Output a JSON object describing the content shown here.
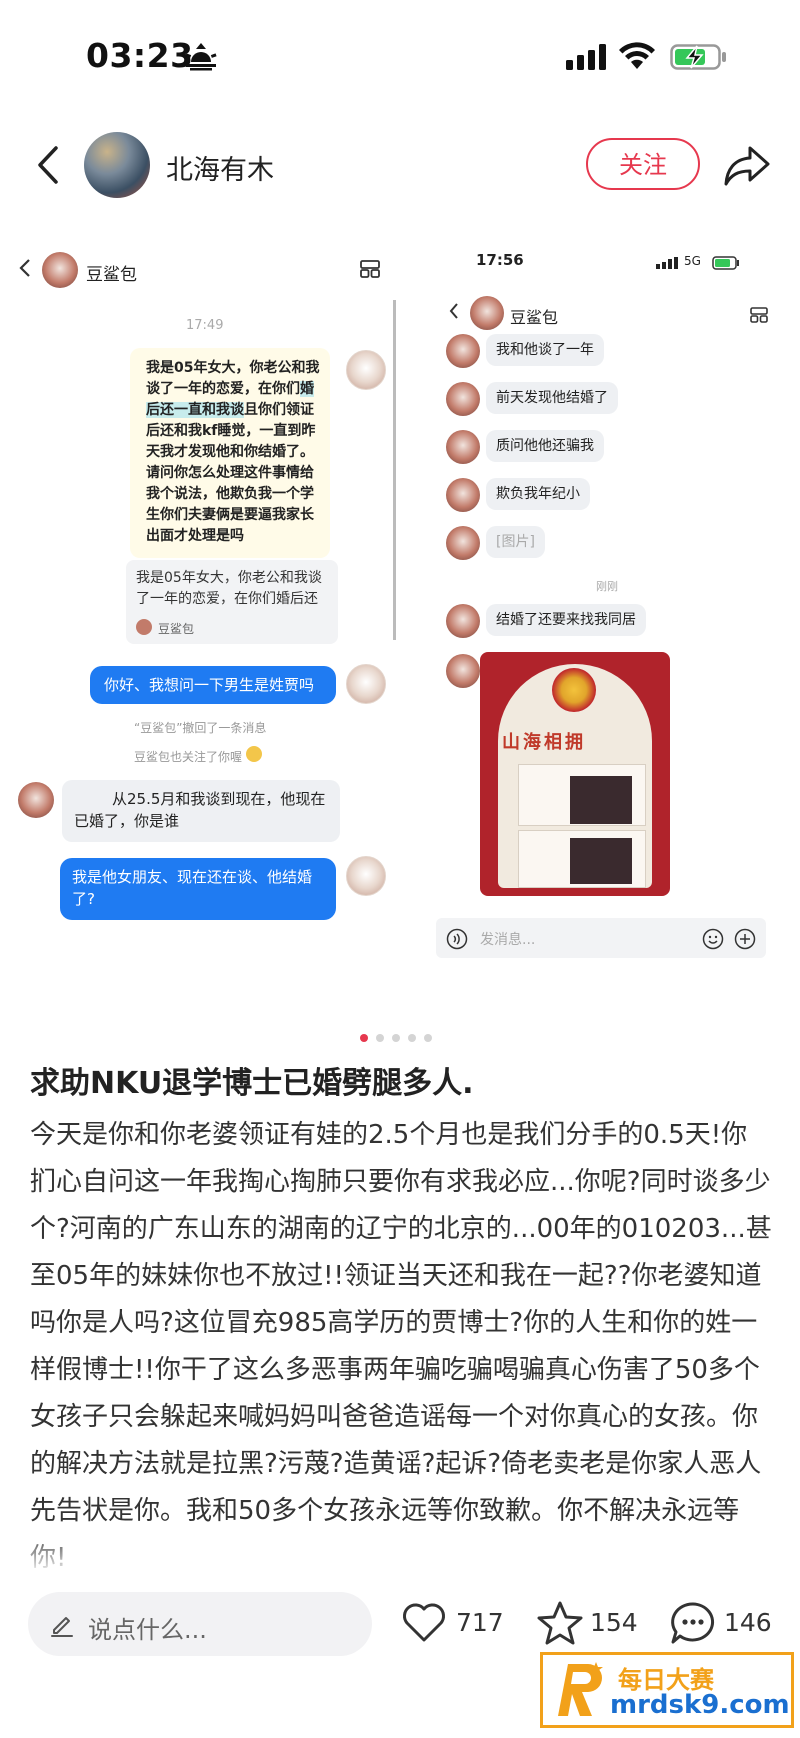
{
  "status_bar": {
    "time": "03:23"
  },
  "header": {
    "author": "北海有木",
    "follow_label": "关注"
  },
  "left_chat": {
    "contact_name": "豆鲨包",
    "time_label": "17:49",
    "image_message_pre": "我是05年女大，你老公和我谈了一年的恋爱，在你们",
    "image_message_highlight": "婚后还一直和我谈",
    "image_message_post": "且你们领证后还和我kf睡觉，一直到昨天我才发现他和你结婚了。请问你怎么处理这件事情给我个说法，他欺负我一个学生你们夫妻俩是要逼我家长出面才处理是吗",
    "quote_text": "我是05年女大，你老公和我谈了一年的恋爱，在你们婚后还",
    "quote_name": "豆鲨包",
    "msg_question": "你好、我想问一下男生是姓贾吗",
    "sys_recalled": "“豆鲨包”撤回了一条消息",
    "sys_followed": "豆鲨包也关注了你喔",
    "reply_from_contact": "从25.5月和我谈到现在，他现在已婚了，你是谁",
    "msg_answer": "我是他女朋友、现在还在谈、他结婚了?"
  },
  "right_chat": {
    "time": "17:56",
    "status_right": "5G",
    "contact_name": "豆鲨包",
    "messages": [
      "我和他谈了一年",
      "前天发现他结婚了",
      "质问他他还骗我",
      "欺负我年纪小",
      "[图片]"
    ],
    "sys_just_now": "刚刚",
    "msg_after": "结婚了还要来找我同居",
    "photo_sign": "山海相拥",
    "input_placeholder": "发消息..."
  },
  "post": {
    "title": "求助NKU退学博士已婚劈腿多人.",
    "body": "今天是你和你老婆领证有娃的2.5个月也是我们分手的0.5天!你扪心自问这一年我掏心掏肺只要你有求我必应...你呢?同时谈多少个?河南的广东山东的湖南的辽宁的北京的...00年的010203...甚至05年的妹妹你也不放过!!领证当天还和我在一起??你老婆知道吗你是人吗?这位冒充985高学历的贾博士?你的人生和你的姓一样假博士!!你干了这么多恶事两年骗吃骗喝骗真心伤害了50多个女孩子只会躲起来喊妈妈叫爸爸造谣每一个对你真心的女孩。你的解决方法就是拉黑?污蔑?造黄谣?起诉?倚老卖老是你家人恶人先告状是你。我和50多个女孩永远等你致歉。你不解决永远等你!"
  },
  "bottom_bar": {
    "comment_placeholder": "说点什么...",
    "like_count": "717",
    "collect_count": "154",
    "comment_count": "146"
  },
  "watermark": {
    "line1": "每日大赛",
    "line2": "mrdsk9.com"
  },
  "colors": {
    "accent": "#e6384e",
    "chat_blue": "#1f7bf2",
    "watermark_orange": "#f2a11a",
    "watermark_blue": "#1a6fd0"
  },
  "icons": [
    "sunrise-icon",
    "signal-icon",
    "wifi-icon",
    "battery-charging-icon",
    "back-icon",
    "share-icon",
    "heart-icon",
    "star-icon",
    "comment-icon",
    "pen-icon"
  ]
}
